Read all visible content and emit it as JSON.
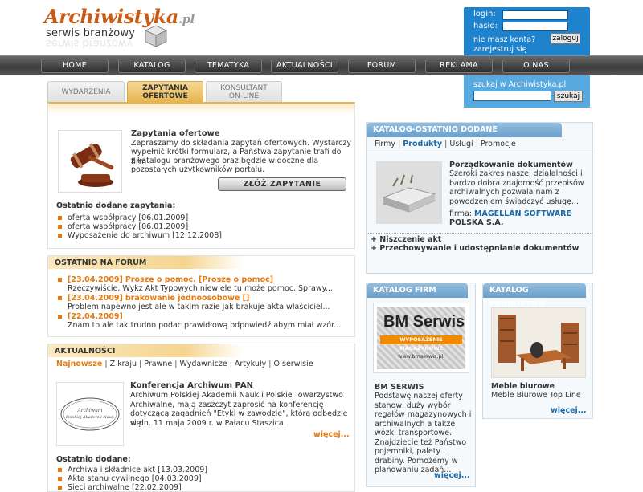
{
  "logo": {
    "name": "Archiwistyka",
    "tld": ".pl",
    "tagline": "serwis branżowy"
  },
  "login": {
    "login_label": "login:",
    "password_label": "hasło:",
    "no_account": "nie masz konta?",
    "register": "zarejestruj się",
    "submit": "zaloguj"
  },
  "nav": [
    "HOME",
    "KATALOG",
    "TEMATYKA",
    "AKTUALNOŚCI",
    "FORUM",
    "REKLAMA",
    "O NAS"
  ],
  "search": {
    "label": "szukaj w Archiwistyka.pl",
    "button": "szukaj"
  },
  "tabs": [
    {
      "line1": "WYDARZENIA",
      "line2": ""
    },
    {
      "line1": "ZAPYTANIA",
      "line2": "OFERTOWE"
    },
    {
      "line1": "KONSULTANT",
      "line2": "ON-LINE"
    }
  ],
  "inquiries": {
    "title": "Zapytania ofertowe",
    "text": [
      "Zapraszamy do składania zapytań ofertowych. Wystarczy",
      "wypełnić krótki formularz, a Państwa zapytanie trafi do firm",
      "z katalogu branżowego oraz będzie widoczne dla",
      "pozostałych użytkowników portalu."
    ],
    "button": "ZŁÓŻ ZAPYTANIE",
    "recent_title": "Ostatnio dodane zapytania:",
    "items": [
      {
        "t": "oferta współpracy",
        "d": "[06.01.2009]"
      },
      {
        "t": "oferta współpracy",
        "d": "[06.01.2009]"
      },
      {
        "t": "Wyposażenie do archiwum",
        "d": "[12.12.2008]"
      }
    ]
  },
  "forum": {
    "title": "OSTATNIO NA FORUM",
    "items": [
      {
        "date": "[23.04.2009]",
        "title": "Proszę o pomoc. [Proszę o pomoc]",
        "text": "Rzeczywiście, Wykz Akt Typowych niewiele tu może pomoc. Sprawy..."
      },
      {
        "date": "[23.04.2009]",
        "title": "brakowanie jednoosobowe []",
        "text": "Problem napewno jest ale w takim razie jak brakuje akta właściciel..."
      },
      {
        "date": "[22.04.2009]",
        "title": "",
        "text": "Znam to ale tak trudno podac prawidłową odpowiedź abym miał wzór..."
      }
    ]
  },
  "news": {
    "title": "AKTUALNOŚCI",
    "filters": [
      "Najnowsze",
      "Z kraju",
      "Prawne",
      "Wydawnicze",
      "Artykuły",
      "O serwisie"
    ],
    "article_title": "Konferencja Archiwum PAN",
    "article_text": [
      "Archiwum Polskiej Akademii Nauk i Polskie Towarzystwo",
      "Archiwalne, mają zaszczyt zaprosić na konferencję",
      "dotyczącą zagadnień \"Etyki w zawodzie\", która odbędzie się",
      "w dn. 11 maja 2009 r. w Pałacu Staszica."
    ],
    "more": "więcej...",
    "seal_text": "Archiwum Polskiej Akademii Nauk",
    "recent_title": "Ostatnio dodane:",
    "items": [
      {
        "t": "Archiwa i składnice akt",
        "d": "[13.03.2009]"
      },
      {
        "t": "Akta stanu cywilnego",
        "d": "[04.03.2009]"
      },
      {
        "t": "Sieci archiwalne",
        "d": "[22.02.2009]"
      }
    ]
  },
  "catalog_recent": {
    "title": "KATALOG-OSTATNIO DODANE",
    "filters": [
      "Firmy",
      "Produkty",
      "Usługi",
      "Promocje"
    ],
    "item_title": "Porządkowanie dokumentów",
    "item_text": [
      "Szeroki zakres naszej działalności i",
      "bardzo dobra znajomość przepisów",
      "archiwalnych pozwala nam z",
      "powodzeniem świadczyć usługę..."
    ],
    "firm_label": "firma:",
    "firm": [
      "MAGELLAN SOFTWARE",
      "POLSKA S.A."
    ],
    "links": [
      "Niszczenie akt",
      "Przechowywanie i udostępnianie dokumentów"
    ]
  },
  "firms": {
    "title": "KATALOG FIRM",
    "logo_big": "BM Serwis",
    "logo_sub": "WYPOSAŻENIE MAGAZYNOWE",
    "logo_url": "www.bmserwis.pl",
    "name": "BM SERWIS",
    "text": [
      "Podstawę naszej oferty",
      "stanowi duży wybór",
      "regałów magazynowych i",
      "archiwalnych a także",
      "wózki transportowe.",
      "Znajdziecie też Państwo",
      "pojemniki, palety i",
      "drabiny. Pomożemy w",
      "planowaniu zadań..."
    ],
    "more": "więcej..."
  },
  "products": {
    "title": "KATALOG PRODUKTÓW",
    "name": "Meble biurowe",
    "sub": "Meble Biurowe Top Line",
    "more": "więcej..."
  },
  "colors": {
    "orange": "#e47a10",
    "blue": "#1a6aa8",
    "nav_dark": "#3d3d3d",
    "login_blue": "#1e82cc"
  }
}
